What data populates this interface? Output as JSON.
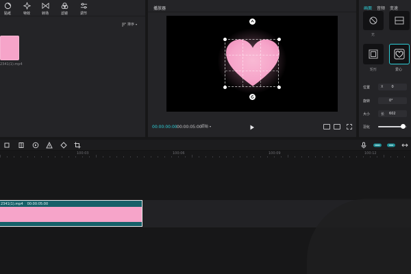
{
  "media_toolbar": {
    "tools": [
      {
        "label": "贴纸",
        "icon": "sticker-icon"
      },
      {
        "label": "特效",
        "icon": "effects-icon"
      },
      {
        "label": "转场",
        "icon": "transition-icon"
      },
      {
        "label": "滤镜",
        "icon": "filter-icon"
      },
      {
        "label": "调节",
        "icon": "adjust-icon"
      }
    ]
  },
  "media": {
    "sort_label": "排序",
    "item_name": "2341(1).mp4",
    "thumb_color": "#f6a4c9"
  },
  "player": {
    "title": "播放器",
    "time_current": "00:00:00:00",
    "time_total": "00:00:05:00",
    "ratio_label": "原始"
  },
  "inspector": {
    "tabs": [
      "画面",
      "音频",
      "变速"
    ],
    "active_tab": "画面",
    "masks": [
      {
        "label": "无",
        "icon": "no-mask-icon"
      },
      {
        "label": "",
        "icon": "split-mask-icon"
      },
      {
        "label": "矩形",
        "icon": "rectangle-mask-icon"
      },
      {
        "label": "爱心",
        "icon": "heart-mask-icon",
        "active": true
      }
    ],
    "props": {
      "position_label": "位置",
      "position_x_label": "X",
      "position_x": "0",
      "rotation_label": "旋转",
      "rotation": "0°",
      "size_label": "大小",
      "size_w_label": "长",
      "size_w": "602",
      "feather_label": "羽化",
      "feather_fraction": 0.85
    }
  },
  "timeline": {
    "ruler_labels": [
      "100:03",
      "100:06",
      "100:09",
      "100:12"
    ],
    "clip": {
      "name": "2341(1).mp4",
      "duration": "00:00:05:00"
    }
  },
  "colors": {
    "accent": "#2ed0d9",
    "clip": "#166068",
    "pink": "#f6a4c9",
    "panel": "#242427"
  }
}
